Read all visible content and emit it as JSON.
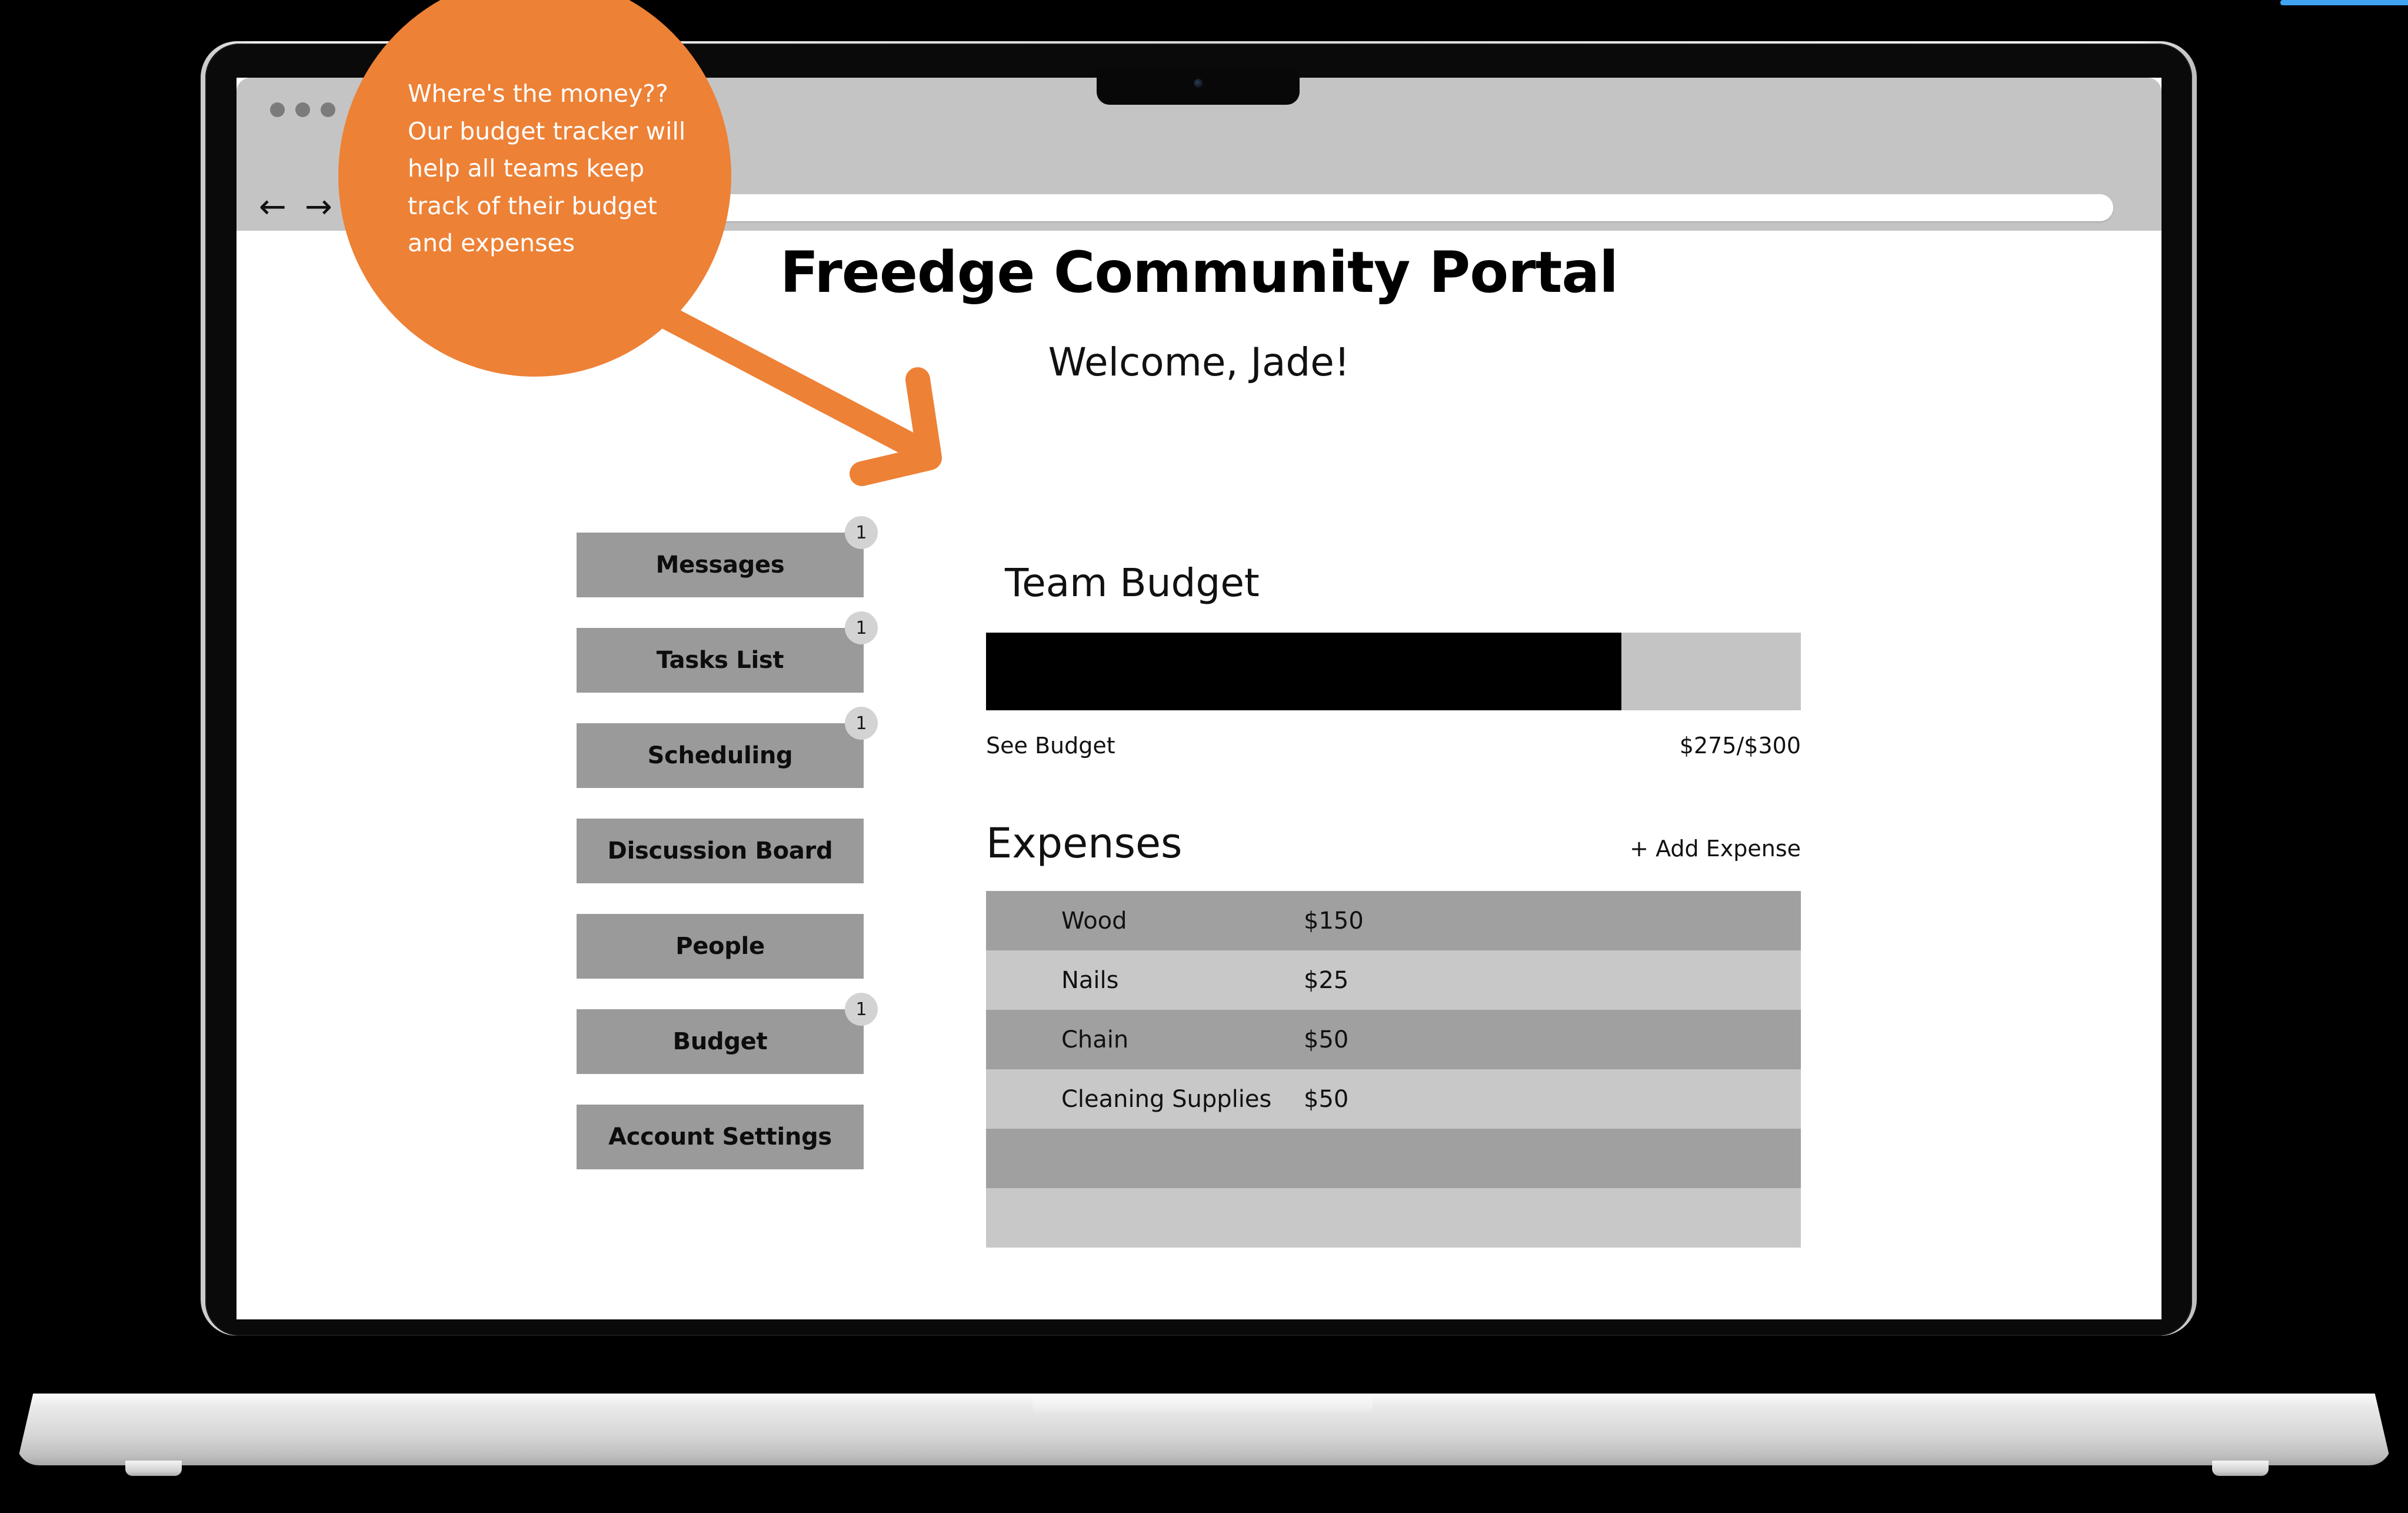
{
  "accent": {
    "orange": "#ED8136",
    "blue": "#3FA3F0",
    "nav_gray": "#9A9A9A",
    "row_dark": "#A0A0A0",
    "row_light": "#C8C8C8"
  },
  "browser": {
    "back_icon": "back-arrow-icon",
    "forward_icon": "forward-arrow-icon",
    "url_value": "",
    "url_placeholder": ""
  },
  "callout": {
    "text": "Where's the money?? Our budget tracker will help all teams keep track of their budget and expenses",
    "arrow_icon": "arrow-pointer-icon"
  },
  "page": {
    "title": "Freedge Community Portal",
    "welcome": "Welcome, Jade!"
  },
  "sidebar": {
    "items": [
      {
        "label": "Messages",
        "badge": "1"
      },
      {
        "label": "Tasks List",
        "badge": "1"
      },
      {
        "label": "Scheduling",
        "badge": "1"
      },
      {
        "label": "Discussion Board",
        "badge": null
      },
      {
        "label": "People",
        "badge": null
      },
      {
        "label": "Budget",
        "badge": "1"
      },
      {
        "label": "Account Settings",
        "badge": null
      }
    ]
  },
  "budget": {
    "title": "Team Budget",
    "see_budget_label": "See Budget",
    "amount_label": "$275/$300",
    "spent": 275,
    "total": 300,
    "fill_percent": 78
  },
  "expenses": {
    "title": "Expenses",
    "add_label": "+ Add Expense",
    "rows": [
      {
        "name": "Wood",
        "amount": "$150"
      },
      {
        "name": "Nails",
        "amount": "$25"
      },
      {
        "name": "Chain",
        "amount": "$50"
      },
      {
        "name": "Cleaning Supplies",
        "amount": "$50"
      },
      {
        "name": "",
        "amount": ""
      },
      {
        "name": "",
        "amount": ""
      }
    ]
  }
}
